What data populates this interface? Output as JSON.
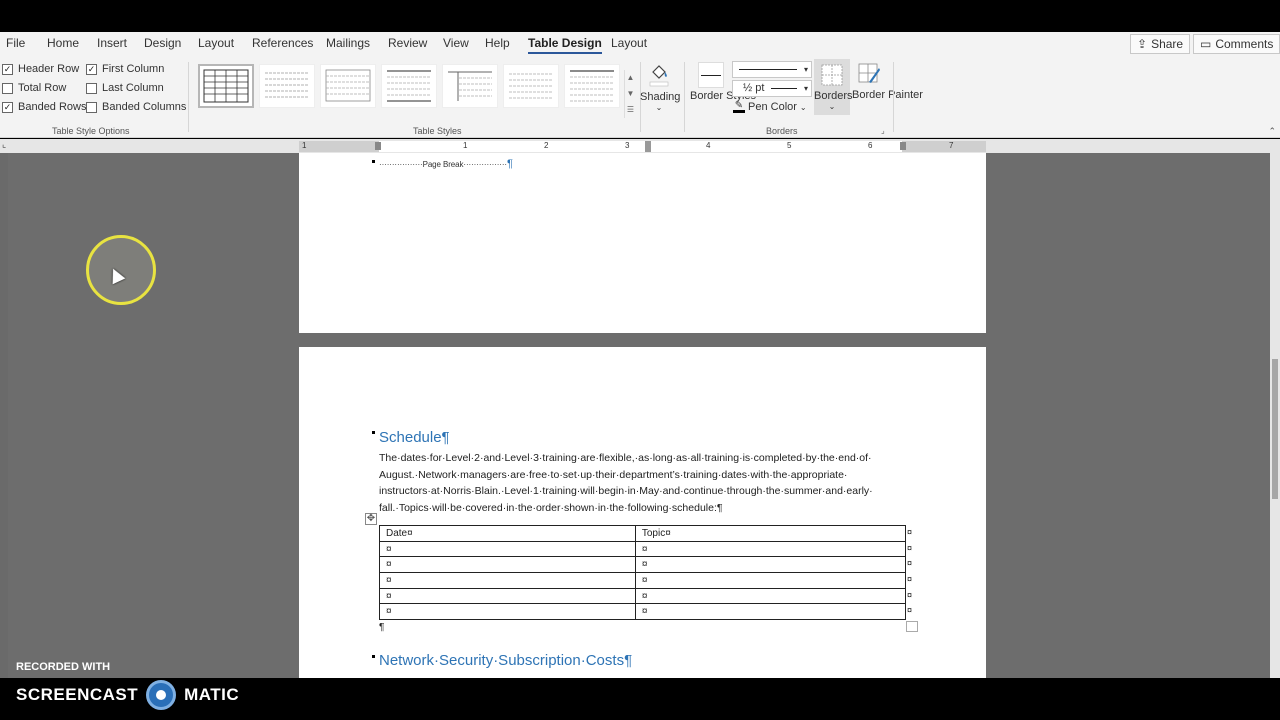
{
  "menu": {
    "tabs": [
      "File",
      "Home",
      "Insert",
      "Design",
      "Layout",
      "References",
      "Mailings",
      "Review",
      "View",
      "Help",
      "Table Design",
      "Layout"
    ],
    "active_tab": "Table Design",
    "share_label": "Share",
    "comments_label": "Comments"
  },
  "ribbon": {
    "style_options": {
      "header_row": "Header Row",
      "total_row": "Total Row",
      "banded_rows": "Banded Rows",
      "first_column": "First Column",
      "last_column": "Last Column",
      "banded_columns": "Banded Columns",
      "group_label": "Table Style Options",
      "checked": {
        "header_row": true,
        "total_row": false,
        "banded_rows": true,
        "first_column": true,
        "last_column": false,
        "banded_columns": false
      }
    },
    "table_styles_label": "Table Styles",
    "shading_label": "Shading",
    "border_styles_label": "Border Styles",
    "pen_weight": "½ pt",
    "pen_color_label": "Pen Color",
    "borders_label": "Borders",
    "border_painter_label": "Border Painter",
    "borders_group_label": "Borders"
  },
  "ruler": {
    "numbers": [
      "1",
      "1",
      "2",
      "3",
      "4",
      "5",
      "6",
      "7"
    ]
  },
  "document": {
    "page_break_text": "·················Page Break·················",
    "schedule_heading": "Schedule¶",
    "schedule_lines": [
      "The·dates·for·Level·2·and·Level·3·training·are·flexible,·as·long·as·all·training·is·completed·by·the·end·of·",
      "August.·Network·managers·are·free·to·set·up·their·department’s·training·dates·with·the·appropriate·",
      "instructors·at·Norris·Blain.·Level·1·training·will·begin·in·May·and·continue·through·the·summer·and·early·",
      "fall.·Topics·will·be·covered·in·the·order·shown·in·the·following·schedule:¶"
    ],
    "table": {
      "headers": [
        "Date¤",
        "Topic¤"
      ],
      "rows": [
        [
          "¤",
          "¤"
        ],
        [
          "¤",
          "¤"
        ],
        [
          "¤",
          "¤"
        ],
        [
          "¤",
          "¤"
        ],
        [
          "¤",
          "¤"
        ]
      ],
      "end_mark": "¤"
    },
    "after_table_mark": "¶",
    "network_heading": "Network·Security·Subscription·Costs¶"
  },
  "watermark": {
    "recorded_with": "RECORDED WITH",
    "brand_left": "SCREENCAST",
    "brand_right": "MATIC"
  }
}
